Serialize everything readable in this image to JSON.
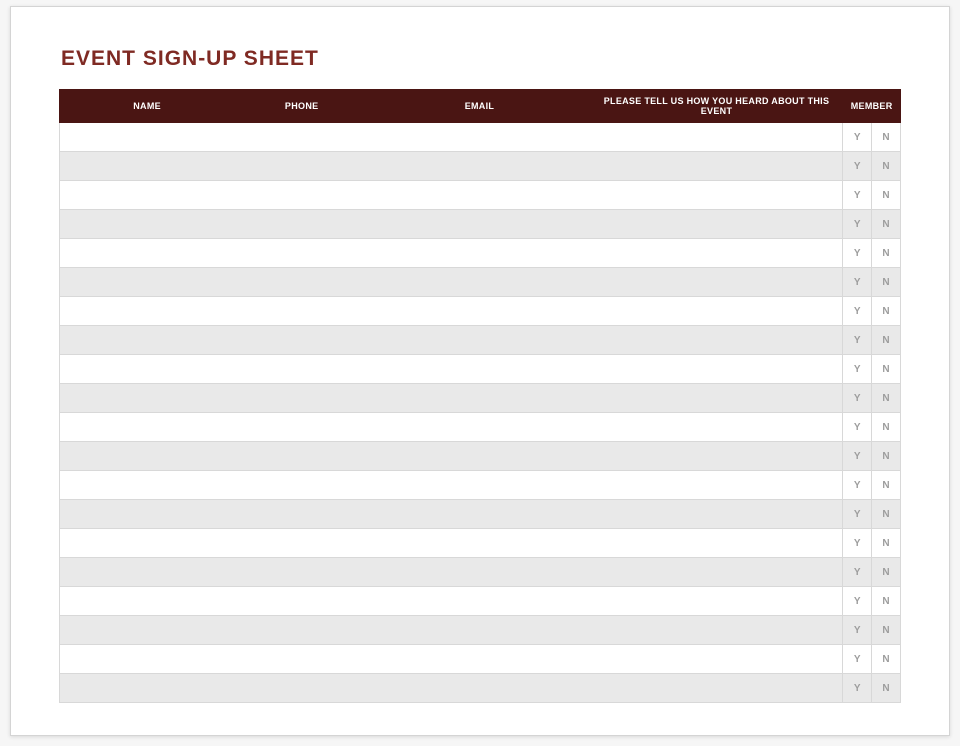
{
  "title": "EVENT SIGN-UP SHEET",
  "columns": {
    "name": "NAME",
    "phone": "PHONE",
    "email": "EMAIL",
    "heard": "PLEASE TELL US HOW YOU HEARD ABOUT THIS EVENT",
    "member": "MEMBER"
  },
  "yn": {
    "y": "Y",
    "n": "N"
  },
  "row_count": 20
}
